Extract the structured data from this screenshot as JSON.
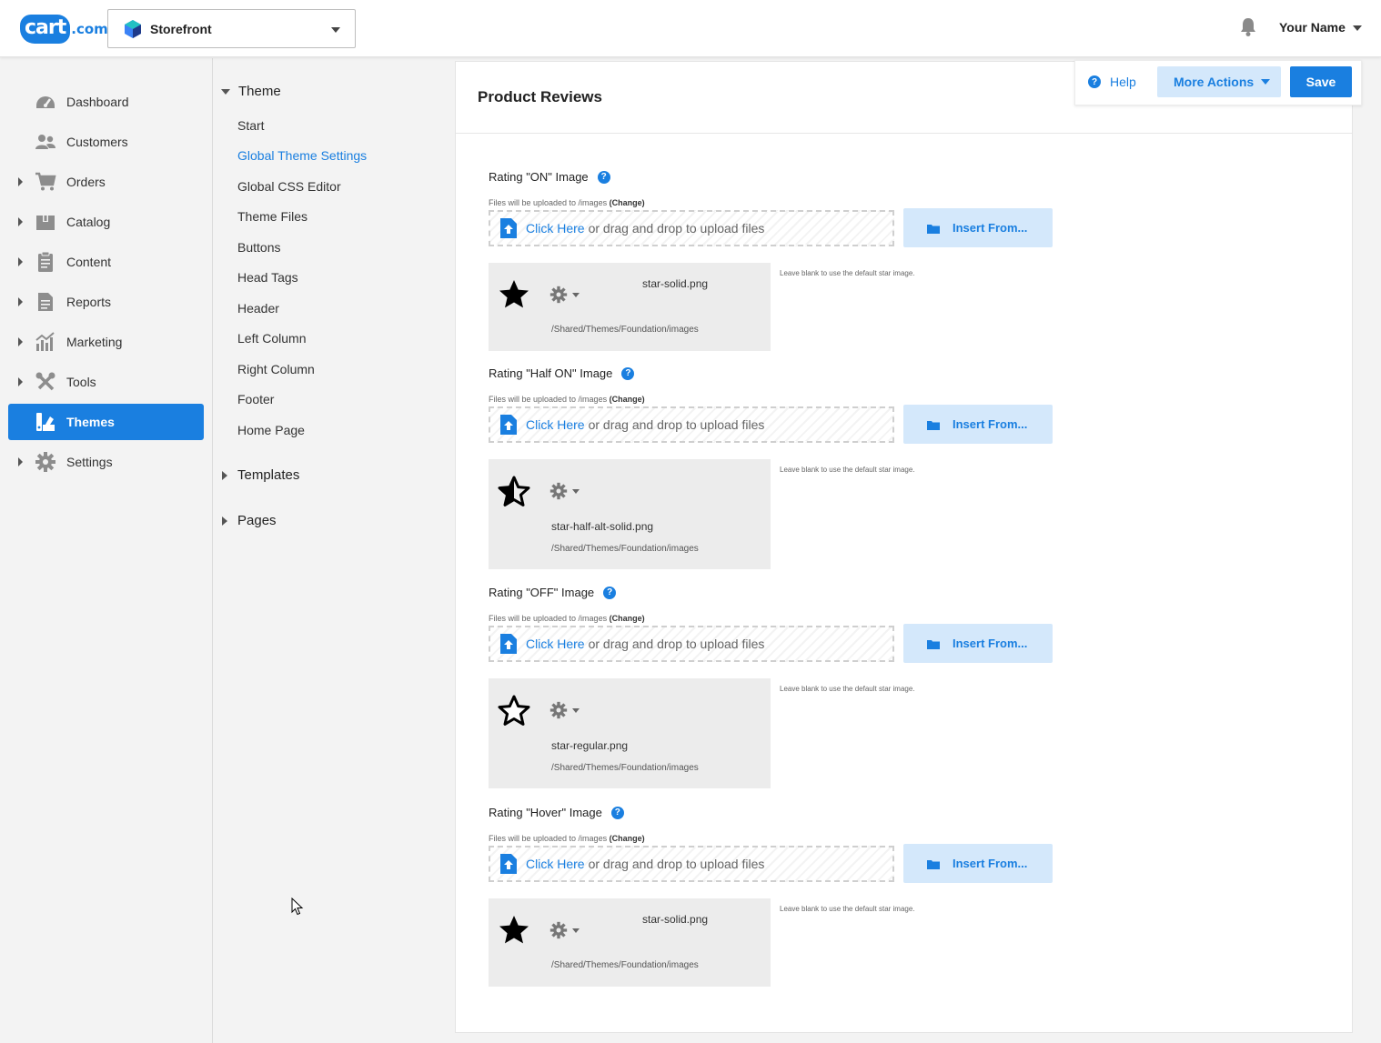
{
  "brand": {
    "logo_main": "cart",
    "logo_suffix": ".com"
  },
  "store_selector": {
    "value": "Storefront"
  },
  "user": {
    "name": "Your Name"
  },
  "icons": {
    "bell": "bell-icon",
    "dashboard": "dashboard-icon",
    "customers": "customers-icon",
    "orders": "cart-icon",
    "catalog": "box-icon",
    "content": "clipboard-icon",
    "reports": "document-icon",
    "marketing": "chart-icon",
    "tools": "tools-icon",
    "themes": "palette-icon",
    "settings": "gear-icon"
  },
  "colors": {
    "accent": "#1a7fe0",
    "accent_light": "#d4e8fb"
  },
  "sidebar": {
    "items": [
      {
        "label": "Dashboard",
        "expandable": false
      },
      {
        "label": "Customers",
        "expandable": false
      },
      {
        "label": "Orders",
        "expandable": true
      },
      {
        "label": "Catalog",
        "expandable": true
      },
      {
        "label": "Content",
        "expandable": true
      },
      {
        "label": "Reports",
        "expandable": true
      },
      {
        "label": "Marketing",
        "expandable": true
      },
      {
        "label": "Tools",
        "expandable": true
      },
      {
        "label": "Themes",
        "expandable": false,
        "active": true
      },
      {
        "label": "Settings",
        "expandable": true
      }
    ]
  },
  "theme_menu": {
    "section_label": "Theme",
    "items": [
      "Start",
      "Global Theme Settings",
      "Global CSS Editor",
      "Theme Files",
      "Buttons",
      "Head Tags",
      "Header",
      "Left Column",
      "Right Column",
      "Footer",
      "Home Page"
    ],
    "active_item": "Global Theme Settings",
    "templates_label": "Templates",
    "pages_label": "Pages"
  },
  "actions": {
    "help": "Help",
    "more_actions": "More Actions",
    "save": "Save"
  },
  "page": {
    "title": "Product Reviews"
  },
  "rating_images": [
    {
      "label": "Rating \"ON\" Image",
      "upload_note": "Files will be uploaded to /images",
      "change_label": "(Change)",
      "dropzone_link": "Click Here",
      "dropzone_text": "or drag and drop to upload files",
      "insert_label": "Insert From...",
      "file_name": "star-solid.png",
      "file_path": "/Shared/Themes/Foundation/images",
      "star": "solid",
      "blank_note": "Leave blank to use the default star image."
    },
    {
      "label": "Rating \"Half ON\" Image",
      "upload_note": "Files will be uploaded to /images",
      "change_label": "(Change)",
      "dropzone_link": "Click Here",
      "dropzone_text": "or drag and drop to upload files",
      "insert_label": "Insert From...",
      "file_name": "star-half-alt-solid.png",
      "file_path": "/Shared/Themes/Foundation/images",
      "star": "half",
      "blank_note": "Leave blank to use the default star image."
    },
    {
      "label": "Rating \"OFF\" Image",
      "upload_note": "Files will be uploaded to /images",
      "change_label": "(Change)",
      "dropzone_link": "Click Here",
      "dropzone_text": "or drag and drop to upload files",
      "insert_label": "Insert From...",
      "file_name": "star-regular.png",
      "file_path": "/Shared/Themes/Foundation/images",
      "star": "regular",
      "blank_note": "Leave blank to use the default star image."
    },
    {
      "label": "Rating \"Hover\" Image",
      "upload_note": "Files will be uploaded to /images",
      "change_label": "(Change)",
      "dropzone_link": "Click Here",
      "dropzone_text": "or drag and drop to upload files",
      "insert_label": "Insert From...",
      "file_name": "star-solid.png",
      "file_path": "/Shared/Themes/Foundation/images",
      "star": "solid",
      "blank_note": "Leave blank to use the default star image."
    }
  ]
}
